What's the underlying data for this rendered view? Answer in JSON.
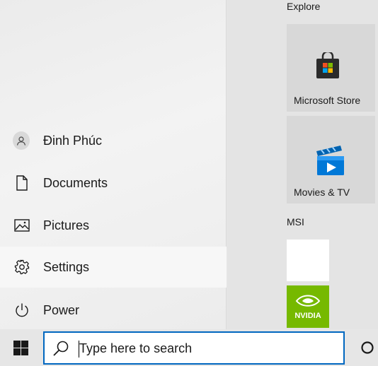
{
  "start_menu": {
    "items": [
      {
        "label": "Đinh Phúc",
        "icon": "user-avatar-icon"
      },
      {
        "label": "Documents",
        "icon": "document-icon"
      },
      {
        "label": "Pictures",
        "icon": "pictures-icon"
      },
      {
        "label": "Settings",
        "icon": "gear-icon"
      },
      {
        "label": "Power",
        "icon": "power-icon"
      }
    ],
    "groups": [
      {
        "title": "Explore",
        "tiles": [
          {
            "label": "Microsoft Store",
            "icon": "microsoft-store-icon"
          },
          {
            "label": "Movies & TV",
            "icon": "movies-tv-icon"
          }
        ]
      },
      {
        "title": "MSI",
        "tiles": [
          {
            "label": "",
            "icon": "audio-wave-icon"
          },
          {
            "label": "",
            "icon": "nvidia-icon"
          }
        ]
      }
    ]
  },
  "taskbar": {
    "start_icon": "windows-logo-icon",
    "search_placeholder": "Type here to search",
    "search_icon": "search-icon",
    "cortana_icon": "cortana-circle-icon"
  },
  "colors": {
    "accent": "#0067c0",
    "nvidia_green": "#76b900",
    "store_bag": "#2b2b2b"
  }
}
